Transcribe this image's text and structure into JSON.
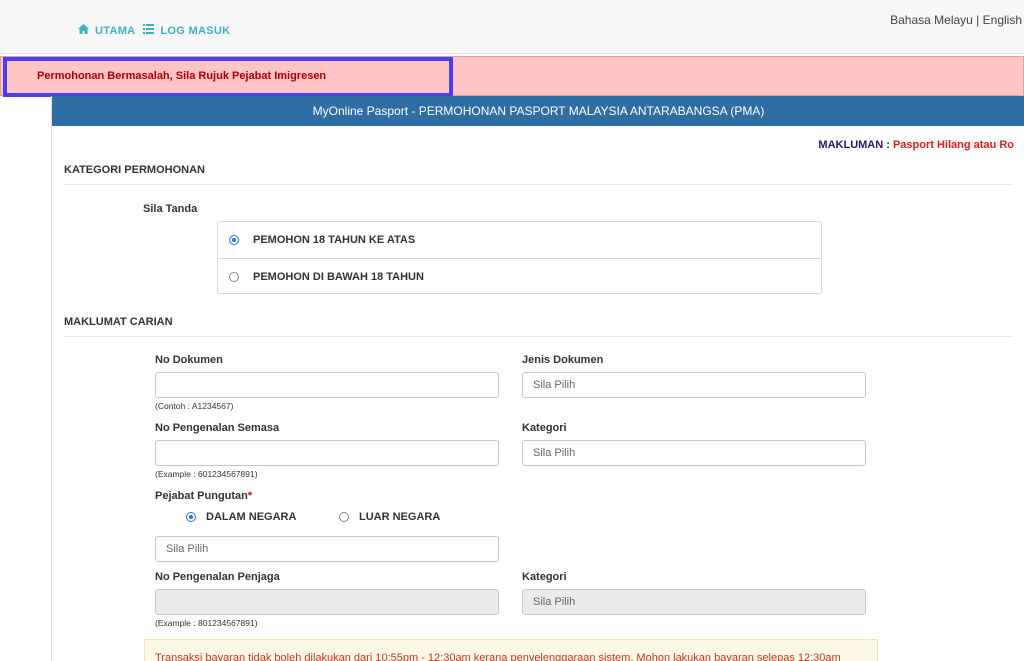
{
  "nav": {
    "home_label": "UTAMA",
    "login_label": "LOG MASUK",
    "home_icon": "home-icon",
    "login_icon": "list-icon"
  },
  "language": {
    "malay": "Bahasa Melayu",
    "separator": "|",
    "english": "English"
  },
  "alert": {
    "text": "Permohonan Bermasalah, Sila Rujuk Pejabat Imigresen"
  },
  "panel": {
    "title": "MyOnline Pasport - PERMOHONAN PASPORT MALAYSIA ANTARABANGSA (PMA)"
  },
  "makluman": {
    "label": "MAKLUMAN :",
    "text": "Pasport Hilang atau Ro"
  },
  "kategori": {
    "heading": "KATEGORI PERMOHONAN",
    "sila_tanda": "Sila Tanda",
    "options": [
      {
        "label": "PEMOHON 18 TAHUN KE ATAS",
        "selected": true
      },
      {
        "label": "PEMOHON DI BAWAH 18 TAHUN",
        "selected": false
      }
    ]
  },
  "carian": {
    "heading": "MAKLUMAT CARIAN",
    "no_dokumen_label": "No Dokumen",
    "no_dokumen_value": "",
    "no_dokumen_hint": "(Contoh : A1234567)",
    "jenis_dokumen_label": "Jenis Dokumen",
    "jenis_dokumen_placeholder": "Sila Pilih",
    "no_pengenalan_label": "No Pengenalan Semasa",
    "no_pengenalan_value": "",
    "no_pengenalan_hint": "(Example : 601234567891)",
    "kategori_label": "Kategori",
    "kategori_placeholder": "Sila Pilih",
    "pejabat_label": "Pejabat Pungutan",
    "pejabat_required": "*",
    "pejabat_options": [
      {
        "label": "DALAM NEGARA",
        "selected": true
      },
      {
        "label": "LUAR NEGARA",
        "selected": false
      }
    ],
    "pejabat_placeholder": "Sila Pilih",
    "penjaga_label": "No Pengenalan Penjaga",
    "penjaga_value": "",
    "penjaga_hint": "(Example : 801234567891)",
    "kategori2_label": "Kategori",
    "kategori2_placeholder": "Sila Pilih"
  },
  "notice": {
    "text": "Transaksi bayaran tidak boleh dilakukan dari 10:55pm - 12:30am kerana penyelenggaraan sistem. Mohon lakukan bayaran selepas 12:30am"
  },
  "colors": {
    "header_blue": "#2f6ea5",
    "nav_teal": "#39b3c6",
    "alert_bg": "#ffc4c4",
    "alert_text": "#b00000",
    "highlight_border": "#4a3cf0",
    "notice_bg": "#fcf8e3"
  }
}
